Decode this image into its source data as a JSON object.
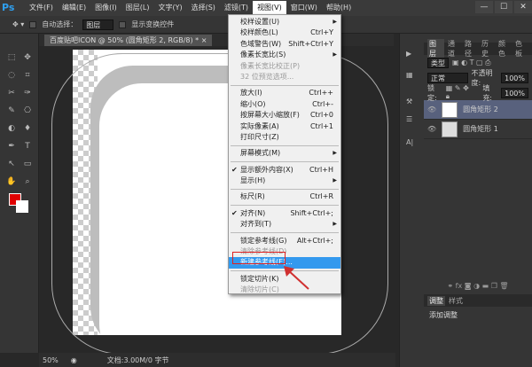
{
  "app": {
    "logo": "Ps",
    "window_buttons": [
      "—",
      "☐",
      "✕"
    ]
  },
  "menubar": [
    "文件(F)",
    "编辑(E)",
    "图像(I)",
    "图层(L)",
    "文字(Y)",
    "选择(S)",
    "滤镜(T)",
    "视图(V)",
    "窗口(W)",
    "帮助(H)"
  ],
  "options": {
    "auto_select": "自动选择：",
    "auto_select_value": "图层",
    "show_transform": "显示变换控件"
  },
  "document": {
    "tab": "百度贴吧ICON @ 50% (圆角矩形 2, RGB/8) * ×",
    "zoom": "50%",
    "doc_info": "文档:3.00M/0 字节"
  },
  "view_menu": [
    {
      "label": "校样设置(U)",
      "arrow": true
    },
    {
      "label": "校样颜色(L)",
      "shortcut": "Ctrl+Y"
    },
    {
      "label": "色域警告(W)",
      "shortcut": "Shift+Ctrl+Y"
    },
    {
      "label": "像素长宽比(S)",
      "arrow": true
    },
    {
      "label": "像素长宽比校正(P)",
      "disabled": true
    },
    {
      "label": "32 位预览选项...",
      "disabled": true
    },
    {
      "sep": true
    },
    {
      "label": "放大(I)",
      "shortcut": "Ctrl++"
    },
    {
      "label": "缩小(O)",
      "shortcut": "Ctrl+-"
    },
    {
      "label": "按屏幕大小缩放(F)",
      "shortcut": "Ctrl+0"
    },
    {
      "label": "实际像素(A)",
      "shortcut": "Ctrl+1"
    },
    {
      "label": "打印尺寸(Z)"
    },
    {
      "sep": true
    },
    {
      "label": "屏幕模式(M)",
      "arrow": true
    },
    {
      "sep": true
    },
    {
      "label": "显示额外内容(X)",
      "shortcut": "Ctrl+H",
      "checked": true
    },
    {
      "label": "显示(H)",
      "arrow": true
    },
    {
      "sep": true
    },
    {
      "label": "标尺(R)",
      "shortcut": "Ctrl+R"
    },
    {
      "sep": true
    },
    {
      "label": "对齐(N)",
      "shortcut": "Shift+Ctrl+;",
      "checked": true
    },
    {
      "label": "对齐到(T)",
      "arrow": true
    },
    {
      "sep": true
    },
    {
      "label": "锁定参考线(G)",
      "shortcut": "Alt+Ctrl+;"
    },
    {
      "label": "清除参考线(D)",
      "disabled": true
    },
    {
      "label": "新建参考线(E)...",
      "highlighted": true
    },
    {
      "sep": true
    },
    {
      "label": "锁定切片(K)"
    },
    {
      "label": "清除切片(C)",
      "disabled": true
    }
  ],
  "layers_panel": {
    "tabs": [
      "图层",
      "通道",
      "路径",
      "历史",
      "颜色",
      "色板"
    ],
    "filter": "类型",
    "blend_mode": "正常",
    "opacity_label": "不透明度:",
    "opacity": "100%",
    "lock_label": "锁定:",
    "fill_label": "填充:",
    "fill": "100%",
    "layers": [
      {
        "name": "圆角矩形 2",
        "selected": true
      },
      {
        "name": "圆角矩形 1",
        "selected": false
      }
    ]
  },
  "adjust_panel": {
    "tabs": [
      "调整",
      "样式"
    ],
    "add_label": "添加调整"
  },
  "colors": {
    "foreground": "#e00000",
    "background": "#ffffff",
    "highlight": "#3399ee",
    "annotation": "#e02020"
  }
}
